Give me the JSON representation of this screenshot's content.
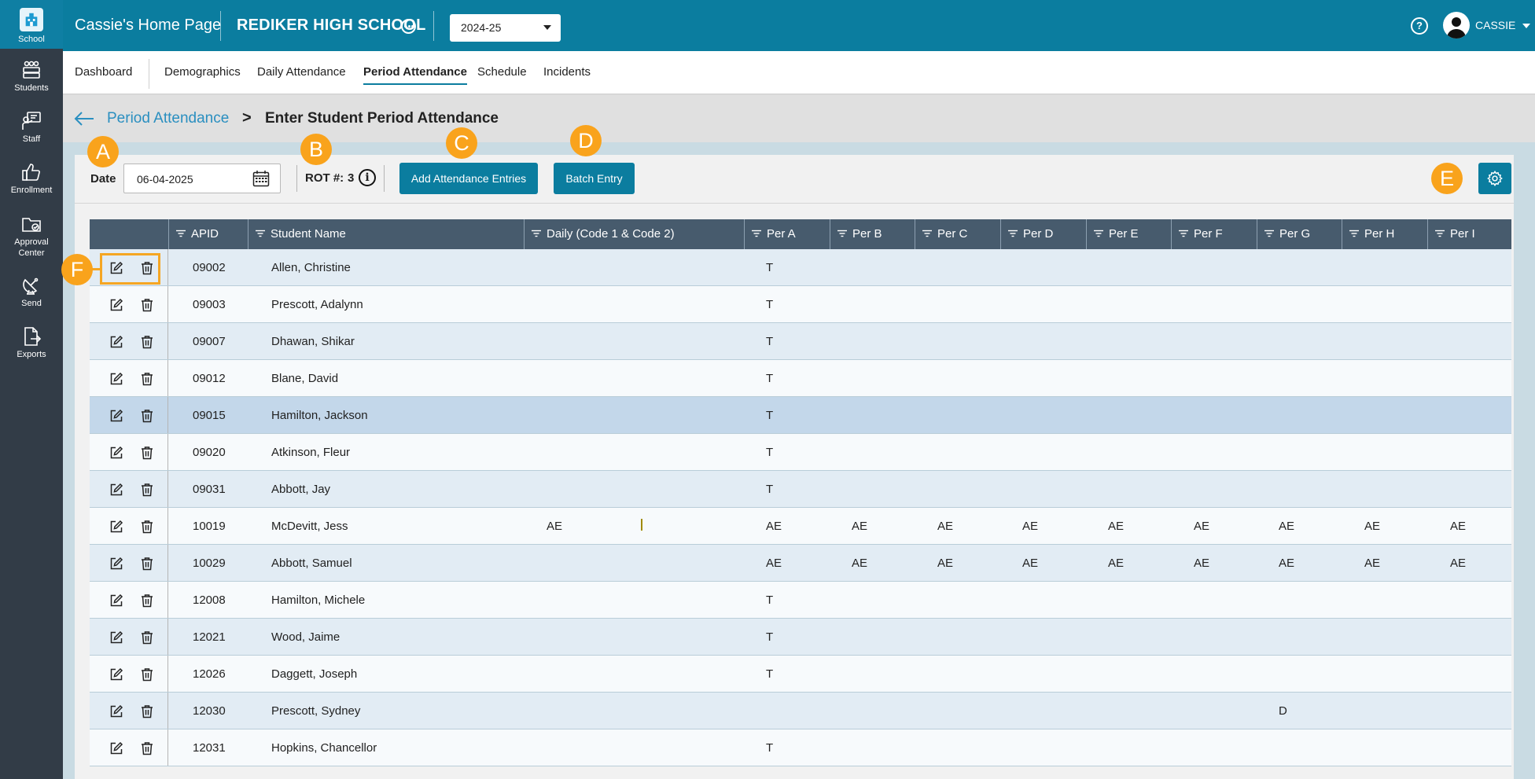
{
  "sidebar": {
    "items": [
      {
        "label": "School",
        "icon": "school-icon",
        "active": true
      },
      {
        "label": "Students",
        "icon": "students-icon"
      },
      {
        "label": "Staff",
        "icon": "staff-icon"
      },
      {
        "label": "Enrollment",
        "icon": "thumbs-up-icon"
      },
      {
        "label": "Approval Center",
        "icon": "folder-check-icon"
      },
      {
        "label": "Send",
        "icon": "satellite-dish-icon"
      },
      {
        "label": "Exports",
        "icon": "file-export-icon"
      }
    ]
  },
  "header": {
    "home_title": "Cassie's Home Page",
    "school_name": "REDIKER HIGH SCHOOL",
    "year": "2024-25",
    "help": "?",
    "user": "CASSIE",
    "accent": "#0b7d9f"
  },
  "nav": {
    "tabs": [
      "Dashboard",
      "Demographics",
      "Daily Attendance",
      "Period Attendance",
      "Schedule",
      "Incidents"
    ],
    "active": "Period Attendance"
  },
  "breadcrumb": {
    "parent": "Period Attendance",
    "separator": ">",
    "current": "Enter Student Period Attendance"
  },
  "toolbar": {
    "date_label": "Date",
    "date_value": "06-04-2025",
    "rot_label": "ROT #:",
    "rot_value": "3",
    "info": "i",
    "add_button": "Add Attendance Entries",
    "batch_button": "Batch Entry"
  },
  "markers": {
    "A": "A",
    "B": "B",
    "C": "C",
    "D": "D",
    "E": "E",
    "F": "F",
    "color": "#f9a31c"
  },
  "table": {
    "columns": [
      "APID",
      "Student Name",
      "Daily (Code 1 & Code 2)",
      "Per A",
      "Per B",
      "Per C",
      "Per D",
      "Per E",
      "Per F",
      "Per G",
      "Per H",
      "Per I"
    ],
    "rows": [
      {
        "apid": "09002",
        "name": "Allen, Christine",
        "daily": "",
        "per": [
          "T",
          "",
          "",
          "",
          "",
          "",
          "",
          "",
          ""
        ]
      },
      {
        "apid": "09003",
        "name": "Prescott, Adalynn",
        "daily": "",
        "per": [
          "T",
          "",
          "",
          "",
          "",
          "",
          "",
          "",
          ""
        ]
      },
      {
        "apid": "09007",
        "name": "Dhawan, Shikar",
        "daily": "",
        "per": [
          "T",
          "",
          "",
          "",
          "",
          "",
          "",
          "",
          ""
        ]
      },
      {
        "apid": "09012",
        "name": "Blane, David",
        "daily": "",
        "per": [
          "T",
          "",
          "",
          "",
          "",
          "",
          "",
          "",
          ""
        ]
      },
      {
        "apid": "09015",
        "name": "Hamilton, Jackson",
        "daily": "",
        "per": [
          "T",
          "",
          "",
          "",
          "",
          "",
          "",
          "",
          ""
        ]
      },
      {
        "apid": "09020",
        "name": "Atkinson, Fleur",
        "daily": "",
        "per": [
          "T",
          "",
          "",
          "",
          "",
          "",
          "",
          "",
          ""
        ]
      },
      {
        "apid": "09031",
        "name": "Abbott, Jay",
        "daily": "",
        "per": [
          "T",
          "",
          "",
          "",
          "",
          "",
          "",
          "",
          ""
        ]
      },
      {
        "apid": "10019",
        "name": "McDevitt, Jess",
        "daily": "AE",
        "per": [
          "AE",
          "AE",
          "AE",
          "AE",
          "AE",
          "AE",
          "AE",
          "AE",
          "AE"
        ]
      },
      {
        "apid": "10029",
        "name": "Abbott, Samuel",
        "daily": "",
        "per": [
          "AE",
          "AE",
          "AE",
          "AE",
          "AE",
          "AE",
          "AE",
          "AE",
          "AE"
        ]
      },
      {
        "apid": "12008",
        "name": "Hamilton, Michele",
        "daily": "",
        "per": [
          "T",
          "",
          "",
          "",
          "",
          "",
          "",
          "",
          ""
        ]
      },
      {
        "apid": "12021",
        "name": "Wood, Jaime",
        "daily": "",
        "per": [
          "T",
          "",
          "",
          "",
          "",
          "",
          "",
          "",
          ""
        ]
      },
      {
        "apid": "12026",
        "name": "Daggett, Joseph",
        "daily": "",
        "per": [
          "T",
          "",
          "",
          "",
          "",
          "",
          "",
          "",
          ""
        ]
      },
      {
        "apid": "12030",
        "name": "Prescott, Sydney",
        "daily": "",
        "per": [
          "",
          "",
          "",
          "",
          "",
          "",
          "D",
          "",
          ""
        ]
      },
      {
        "apid": "12031",
        "name": "Hopkins, Chancellor",
        "daily": "",
        "per": [
          "T",
          "",
          "",
          "",
          "",
          "",
          "",
          "",
          ""
        ]
      }
    ],
    "selected_row": 4
  }
}
